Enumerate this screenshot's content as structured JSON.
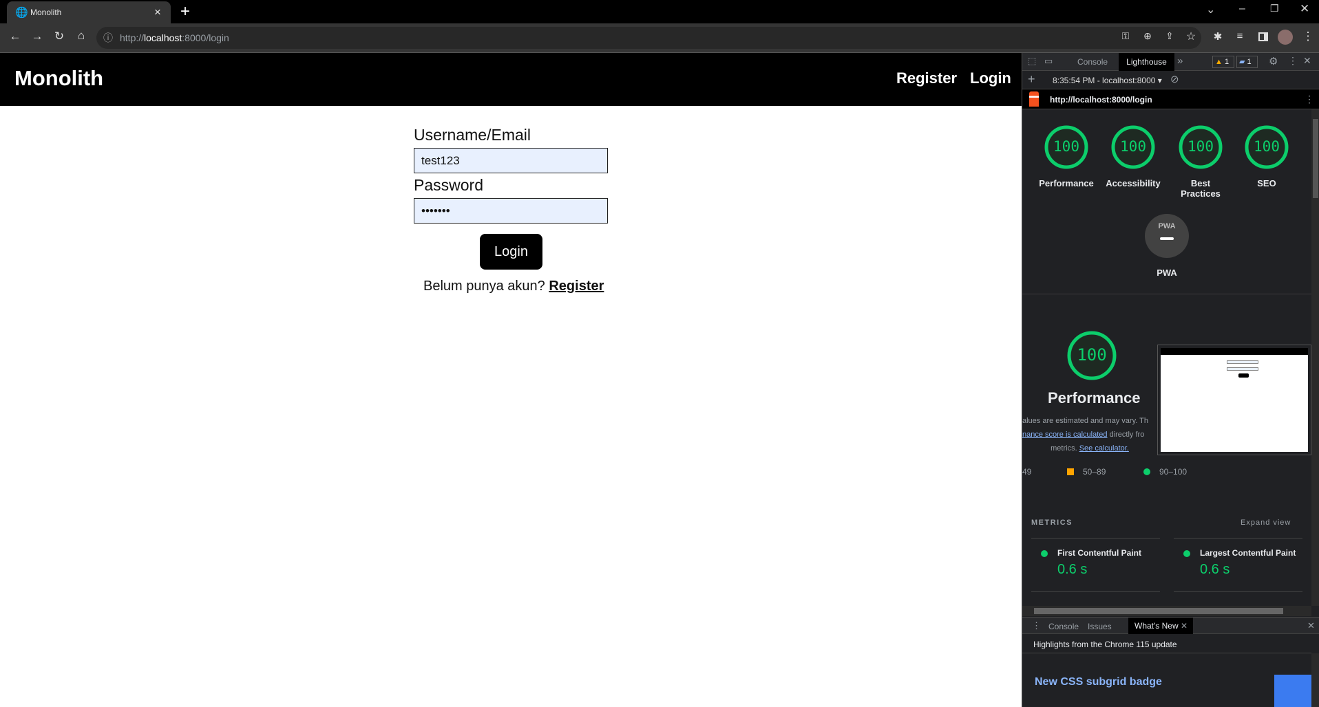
{
  "browser": {
    "tab_title": "Monolith",
    "tab_close": "×",
    "new_tab": "+",
    "url_scheme": "http://",
    "url_host": "localhost",
    "url_rest": ":8000/login"
  },
  "site": {
    "brand": "Monolith",
    "nav": [
      "Register",
      "Login"
    ],
    "form": {
      "username_label": "Username/Email",
      "username_value": "test123",
      "password_label": "Password",
      "password_value": "•••••••",
      "submit": "Login",
      "prompt": "Belum punya akun?",
      "register_link": "Register"
    },
    "colors": {
      "input_bg": "#e8f0fe",
      "nav_bg": "#000000"
    }
  },
  "devtools": {
    "tabs": [
      "Console",
      "Lighthouse"
    ],
    "more": "»",
    "warnings": "1",
    "messages": "1",
    "report_selector": "8:35:54 PM - localhost:8000",
    "report_url": "http://localhost:8000/login",
    "scores": [
      {
        "label": "Performance",
        "value": "100"
      },
      {
        "label": "Accessibility",
        "value": "100"
      },
      {
        "label": "Best Practices",
        "value": "100"
      },
      {
        "label": "SEO",
        "value": "100"
      }
    ],
    "pwa": {
      "badge": "PWA",
      "label": "PWA"
    },
    "performance": {
      "score": "100",
      "title": "Performance",
      "desc1": "alues are estimated and may vary. Th",
      "link1": "nance score is calculated",
      "desc2": " directly fro",
      "desc3": "metrics. ",
      "link2": "See calculator."
    },
    "legend": [
      "49",
      "50–89",
      "90–100"
    ],
    "metrics_title": "METRICS",
    "expand": "Expand view",
    "metrics": [
      {
        "label": "First Contentful Paint",
        "value": "0.6 s"
      },
      {
        "label": "Largest Contentful Paint",
        "value": "0.6 s"
      }
    ],
    "drawer": {
      "tabs": [
        "Console",
        "Issues",
        "What's New"
      ],
      "highlight": "Highlights from the Chrome 115 update",
      "heading": "New CSS subgrid badge"
    },
    "colors": {
      "pass": "#0cce6b",
      "average": "#ffa400",
      "link": "#8ab4f8"
    }
  }
}
